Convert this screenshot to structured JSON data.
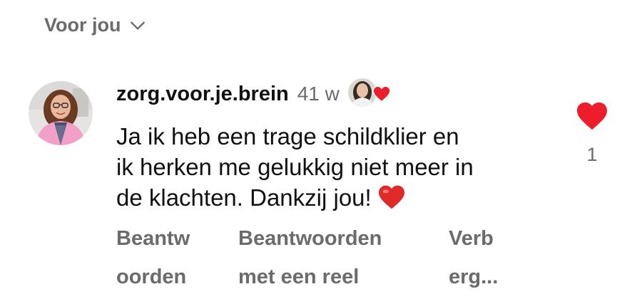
{
  "filter": {
    "label": "Voor jou",
    "icon": "chevron-down-icon"
  },
  "comment": {
    "username": "zorg.voor.je.brein",
    "time": "41 w",
    "liked_by_author": true,
    "text_lines": [
      "Ja ik heb een trage schildklier en",
      "ik herken me gelukkig niet meer in",
      "de klachten. Dankzij jou!"
    ],
    "emoji": "red-heart",
    "like_count": "1"
  },
  "actions": [
    {
      "lines": [
        "Beantw",
        "oorden"
      ]
    },
    {
      "lines": [
        "Beantwoorden",
        "met een reel"
      ]
    },
    {
      "lines": [
        "Verb",
        "erg..."
      ]
    }
  ],
  "colors": {
    "heart": "#ed1d2c",
    "muted_text": "#6b6b6b",
    "text": "#111111",
    "avatar_cardigan": "#f2a0c8"
  }
}
